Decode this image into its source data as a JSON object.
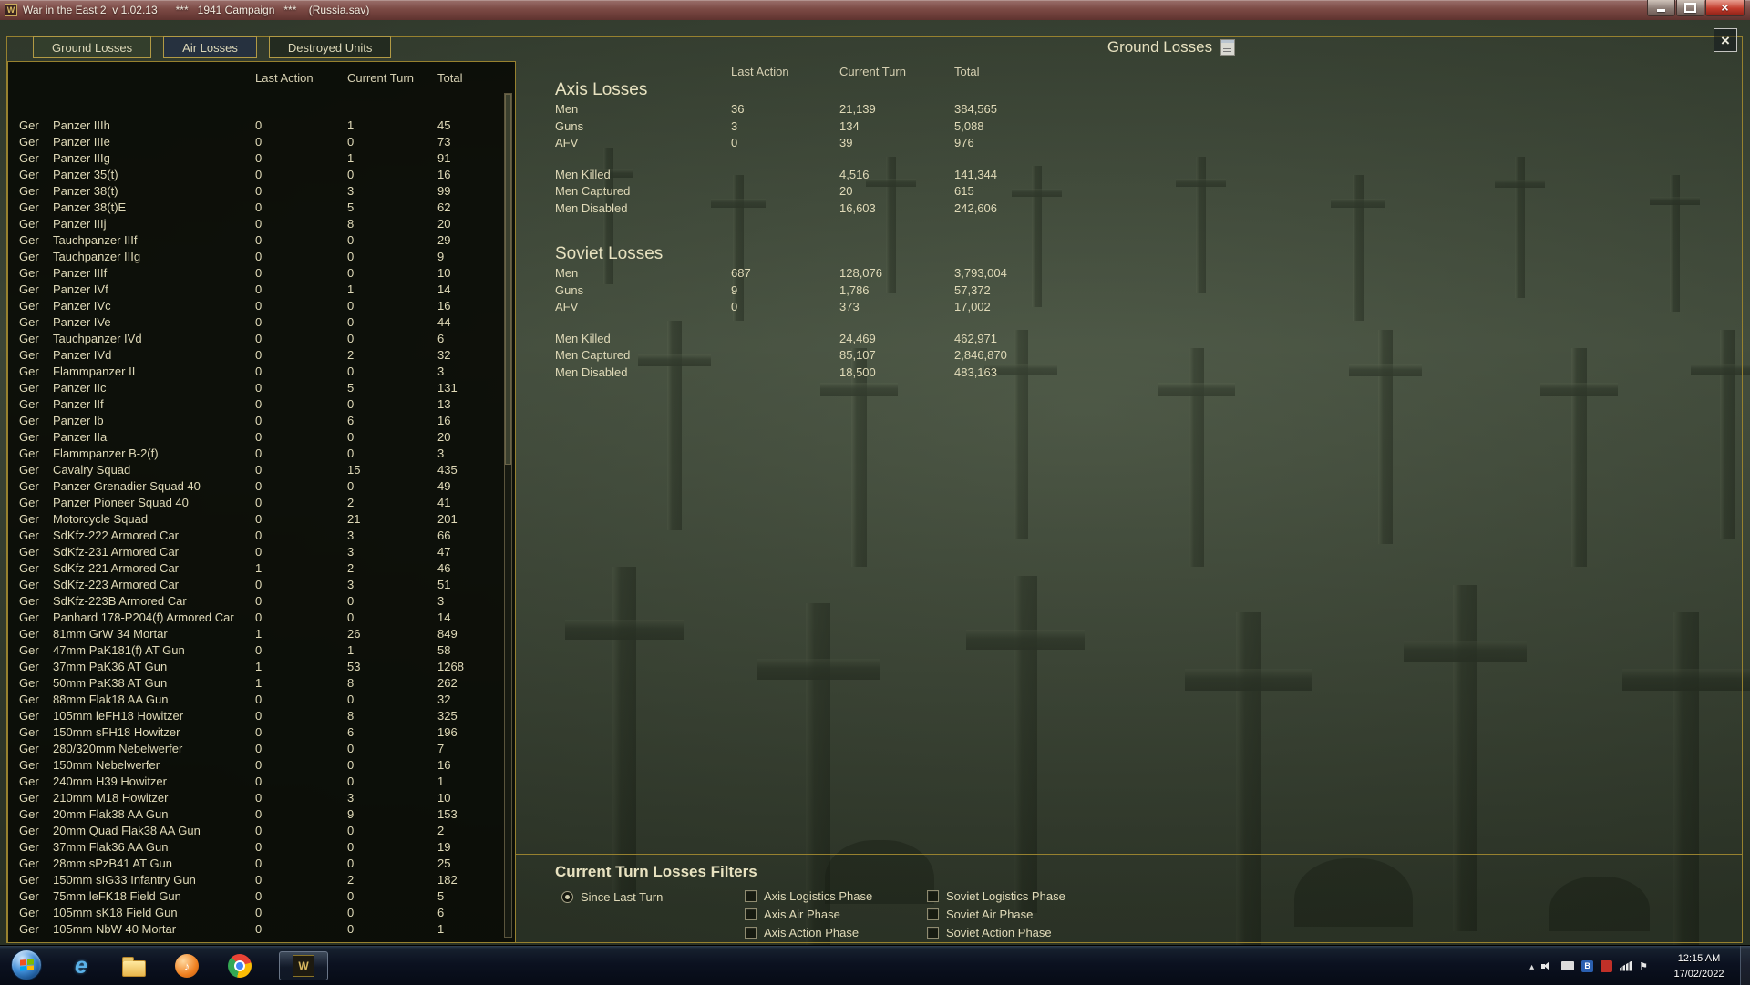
{
  "titlebar": {
    "title": "War in the East 2  v 1.02.13      ***   1941 Campaign   ***    (Russia.sav)"
  },
  "tabs": [
    {
      "label": "Ground Losses",
      "active": true
    },
    {
      "label": "Air Losses",
      "active": false
    },
    {
      "label": "Destroyed Units",
      "active": false
    }
  ],
  "page_title": "Ground Losses",
  "columns": {
    "last_action": "Last Action",
    "current_turn": "Current Turn",
    "total": "Total"
  },
  "left_table": {
    "rows": [
      [
        "Ger",
        "Panzer IIIh",
        "0",
        "1",
        "45"
      ],
      [
        "Ger",
        "Panzer IIIe",
        "0",
        "0",
        "73"
      ],
      [
        "Ger",
        "Panzer IIIg",
        "0",
        "1",
        "91"
      ],
      [
        "Ger",
        "Panzer 35(t)",
        "0",
        "0",
        "16"
      ],
      [
        "Ger",
        "Panzer 38(t)",
        "0",
        "3",
        "99"
      ],
      [
        "Ger",
        "Panzer 38(t)E",
        "0",
        "5",
        "62"
      ],
      [
        "Ger",
        "Panzer IIIj",
        "0",
        "8",
        "20"
      ],
      [
        "Ger",
        "Tauchpanzer IIIf",
        "0",
        "0",
        "29"
      ],
      [
        "Ger",
        "Tauchpanzer IIIg",
        "0",
        "0",
        "9"
      ],
      [
        "Ger",
        "Panzer IIIf",
        "0",
        "0",
        "10"
      ],
      [
        "Ger",
        "Panzer IVf",
        "0",
        "1",
        "14"
      ],
      [
        "Ger",
        "Panzer IVc",
        "0",
        "0",
        "16"
      ],
      [
        "Ger",
        "Panzer IVe",
        "0",
        "0",
        "44"
      ],
      [
        "Ger",
        "Tauchpanzer IVd",
        "0",
        "0",
        "6"
      ],
      [
        "Ger",
        "Panzer IVd",
        "0",
        "2",
        "32"
      ],
      [
        "Ger",
        "Flammpanzer II",
        "0",
        "0",
        "3"
      ],
      [
        "Ger",
        "Panzer IIc",
        "0",
        "5",
        "131"
      ],
      [
        "Ger",
        "Panzer IIf",
        "0",
        "0",
        "13"
      ],
      [
        "Ger",
        "Panzer Ib",
        "0",
        "6",
        "16"
      ],
      [
        "Ger",
        "Panzer IIa",
        "0",
        "0",
        "20"
      ],
      [
        "Ger",
        "Flammpanzer B-2(f)",
        "0",
        "0",
        "3"
      ],
      [
        "Ger",
        "Cavalry Squad",
        "0",
        "15",
        "435"
      ],
      [
        "Ger",
        "Panzer Grenadier Squad 40",
        "0",
        "0",
        "49"
      ],
      [
        "Ger",
        "Panzer Pioneer Squad 40",
        "0",
        "2",
        "41"
      ],
      [
        "Ger",
        "Motorcycle Squad",
        "0",
        "21",
        "201"
      ],
      [
        "Ger",
        "SdKfz-222 Armored Car",
        "0",
        "3",
        "66"
      ],
      [
        "Ger",
        "SdKfz-231 Armored Car",
        "0",
        "3",
        "47"
      ],
      [
        "Ger",
        "SdKfz-221 Armored Car",
        "1",
        "2",
        "46"
      ],
      [
        "Ger",
        "SdKfz-223 Armored Car",
        "0",
        "3",
        "51"
      ],
      [
        "Ger",
        "SdKfz-223B Armored Car",
        "0",
        "0",
        "3"
      ],
      [
        "Ger",
        "Panhard 178-P204(f) Armored Car",
        "0",
        "0",
        "14"
      ],
      [
        "Ger",
        "81mm GrW 34 Mortar",
        "1",
        "26",
        "849"
      ],
      [
        "Ger",
        "47mm PaK181(f) AT Gun",
        "0",
        "1",
        "58"
      ],
      [
        "Ger",
        "37mm PaK36 AT Gun",
        "1",
        "53",
        "1268"
      ],
      [
        "Ger",
        "50mm PaK38 AT Gun",
        "1",
        "8",
        "262"
      ],
      [
        "Ger",
        "88mm Flak18 AA Gun",
        "0",
        "0",
        "32"
      ],
      [
        "Ger",
        "105mm leFH18 Howitzer",
        "0",
        "8",
        "325"
      ],
      [
        "Ger",
        "150mm sFH18 Howitzer",
        "0",
        "6",
        "196"
      ],
      [
        "Ger",
        "280/320mm Nebelwerfer",
        "0",
        "0",
        "7"
      ],
      [
        "Ger",
        "150mm Nebelwerfer",
        "0",
        "0",
        "16"
      ],
      [
        "Ger",
        "240mm H39 Howitzer",
        "0",
        "0",
        "1"
      ],
      [
        "Ger",
        "210mm M18 Howitzer",
        "0",
        "3",
        "10"
      ],
      [
        "Ger",
        "20mm Flak38 AA Gun",
        "0",
        "9",
        "153"
      ],
      [
        "Ger",
        "20mm Quad Flak38 AA Gun",
        "0",
        "0",
        "2"
      ],
      [
        "Ger",
        "37mm Flak36 AA Gun",
        "0",
        "0",
        "19"
      ],
      [
        "Ger",
        "28mm sPzB41 AT Gun",
        "0",
        "0",
        "25"
      ],
      [
        "Ger",
        "150mm sIG33 Infantry Gun",
        "0",
        "2",
        "182"
      ],
      [
        "Ger",
        "75mm leFK18 Field Gun",
        "0",
        "0",
        "5"
      ],
      [
        "Ger",
        "105mm sK18 Field Gun",
        "0",
        "0",
        "6"
      ],
      [
        "Ger",
        "105mm NbW 40 Mortar",
        "0",
        "0",
        "1"
      ]
    ]
  },
  "summary": {
    "axis": {
      "title": "Axis Losses",
      "rows": [
        [
          "Men",
          "36",
          "21,139",
          "384,565"
        ],
        [
          "Guns",
          "3",
          "134",
          "5,088"
        ],
        [
          "AFV",
          "0",
          "39",
          "976"
        ]
      ],
      "detail_rows": [
        [
          "Men Killed",
          "",
          "4,516",
          "141,344"
        ],
        [
          "Men Captured",
          "",
          "20",
          "615"
        ],
        [
          "Men Disabled",
          "",
          "16,603",
          "242,606"
        ]
      ]
    },
    "soviet": {
      "title": "Soviet Losses",
      "rows": [
        [
          "Men",
          "687",
          "128,076",
          "3,793,004"
        ],
        [
          "Guns",
          "9",
          "1,786",
          "57,372"
        ],
        [
          "AFV",
          "0",
          "373",
          "17,002"
        ]
      ],
      "detail_rows": [
        [
          "Men Killed",
          "",
          "24,469",
          "462,971"
        ],
        [
          "Men Captured",
          "",
          "85,107",
          "2,846,870"
        ],
        [
          "Men Disabled",
          "",
          "18,500",
          "483,163"
        ]
      ]
    }
  },
  "filters": {
    "title": "Current Turn Losses Filters",
    "radio_label": "Since Last Turn",
    "radio_selected": true,
    "axis_filters": [
      "Axis Logistics Phase",
      "Axis Air Phase",
      "Axis Action Phase"
    ],
    "soviet_filters": [
      "Soviet Logistics Phase",
      "Soviet Air Phase",
      "Soviet Action Phase"
    ]
  },
  "taskbar": {
    "clock_time": "12:15 AM",
    "clock_date": "17/02/2022"
  },
  "colors": {
    "gold_border": "#97812f",
    "background_green": "#4b5645",
    "panel_dark": "#0d0f08",
    "text_tan": "#e0dab8",
    "titlebar_red": "#7c4a45"
  }
}
